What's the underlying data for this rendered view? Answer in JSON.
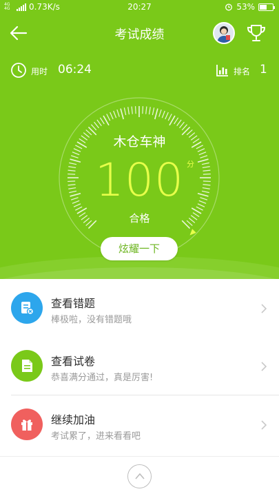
{
  "status_bar": {
    "network": "4G 4G",
    "speed": "0.73K/s",
    "time": "20:27",
    "battery_percent": "53%",
    "battery_level": 0.53
  },
  "header": {
    "title": "考试成绩",
    "icons": [
      "back-arrow-icon",
      "avatar",
      "trophy-icon"
    ]
  },
  "stats": {
    "used_time_label": "用时",
    "used_time_value": "06:24",
    "rank_label": "排名",
    "rank_value": "1"
  },
  "result": {
    "nickname": "木仓车神",
    "score": "100",
    "score_unit": "分",
    "score_max": 100,
    "status": "合格",
    "share_button": "炫耀一下"
  },
  "menu": [
    {
      "title": "查看错题",
      "subtitle": "棒极啦，没有错题哦",
      "icon": "wrong-questions-icon",
      "color": "#2da6ec"
    },
    {
      "title": "查看试卷",
      "subtitle": "恭喜满分通过，真是厉害!",
      "icon": "paper-icon",
      "color": "#7ac919"
    },
    {
      "title": "继续加油",
      "subtitle": "考试累了，进来看看吧",
      "icon": "gift-icon",
      "color": "#f0605e"
    }
  ],
  "colors": {
    "header_green": "#7ac919",
    "score_yellow": "#e7ff4a",
    "blue": "#2da6ec",
    "red": "#f0605e"
  }
}
